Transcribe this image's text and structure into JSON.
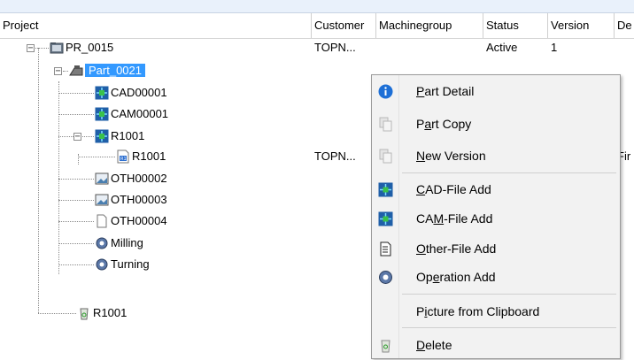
{
  "columns": [
    "Project",
    "Customer",
    "Machinegroup",
    "Status",
    "Version",
    "De"
  ],
  "tree": {
    "root": {
      "label": "PR_0015",
      "customer": "TOPN...",
      "status": "Active",
      "version": "1"
    },
    "part": {
      "label": "Part_0021"
    },
    "cad": {
      "label": "CAD00001"
    },
    "cam": {
      "label": "CAM00001"
    },
    "r1001": {
      "label": "R1001"
    },
    "r1001_child": {
      "label": "R1001",
      "customer": "TOPN...",
      "desc": "Fir"
    },
    "oth2": {
      "label": "OTH00002"
    },
    "oth3": {
      "label": "OTH00003"
    },
    "oth4": {
      "label": "OTH00004"
    },
    "milling": {
      "label": "Milling"
    },
    "turning": {
      "label": "Turning"
    },
    "r1001_bottom": {
      "label": "R1001"
    }
  },
  "context_menu": {
    "items": [
      {
        "pre": "",
        "key": "P",
        "post": "art Detail",
        "icon": "info-icon"
      },
      {
        "pre": "P",
        "key": "a",
        "post": "rt Copy",
        "icon": "copy-icon"
      },
      {
        "pre": "",
        "key": "N",
        "post": "ew Version",
        "icon": "copy-icon"
      },
      {
        "pre": "",
        "key": "C",
        "post": "AD-File Add",
        "icon": "cad-icon"
      },
      {
        "pre": "CA",
        "key": "M",
        "post": "-File Add",
        "icon": "cam-icon"
      },
      {
        "pre": "",
        "key": "O",
        "post": "ther-File Add",
        "icon": "document-icon"
      },
      {
        "pre": "Op",
        "key": "e",
        "post": "ration Add",
        "icon": "gear-icon"
      },
      {
        "pre": "P",
        "key": "i",
        "post": "cture from Clipboard",
        "icon": ""
      },
      {
        "pre": "",
        "key": "D",
        "post": "elete",
        "icon": "recycle-icon"
      }
    ]
  }
}
